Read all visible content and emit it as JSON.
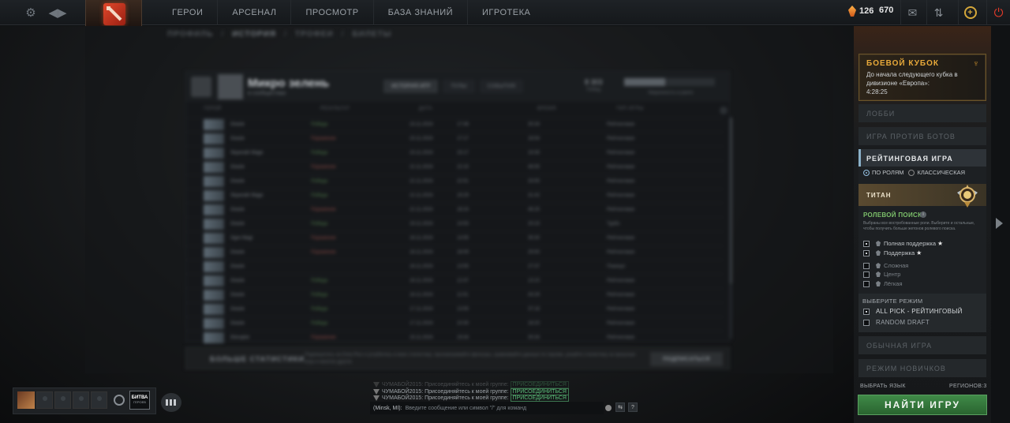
{
  "topbar": {
    "nav": [
      "ГЕРОИ",
      "АРСЕНАЛ",
      "ПРОСМОТР",
      "БАЗА ЗНАНИЙ",
      "ИГРОТЕКА"
    ],
    "shards": "126",
    "gems": "670",
    "icons": [
      "settings-gear-icon",
      "back-forward-icon",
      "dota-logo-icon",
      "mail-icon",
      "plus-icon",
      "power-icon"
    ]
  },
  "breadcrumb": [
    "ПРОФИЛЬ",
    "ИСТОРИЯ",
    "ТРОФЕИ",
    "БИЛЕТЫ"
  ],
  "profile": {
    "name": "Микро зелень",
    "subtitle": "в сообществах",
    "tabs": [
      "ИСТОРИЯ ИГР",
      "ПУЛЫ",
      "СОБЫТИЯ"
    ],
    "stat1": "8 303",
    "stat1_label": "Побед",
    "stat2_label": "Уверенность в ранге",
    "columns": [
      "ГЕРОЙ",
      "РЕЗУЛЬТАТ",
      "ДАТА",
      "",
      "ВРЕМЯ",
      "ТИП ИГРЫ"
    ],
    "matches": [
      {
        "hero": "Oracle",
        "result": "Победа",
        "date": "23.11.2024",
        "time": "17:48",
        "duration": "30:34",
        "type": "Рейтинговая",
        "win": true
      },
      {
        "hero": "Oracle",
        "result": "Поражение",
        "date": "23.11.2024",
        "time": "17:17",
        "duration": "18:54",
        "type": "Рейтинговая",
        "win": false
      },
      {
        "hero": "Skywrath Mage",
        "result": "Победа",
        "date": "23.11.2024",
        "time": "15:17",
        "duration": "19:35",
        "type": "Рейтинговая",
        "win": true
      },
      {
        "hero": "Oracle",
        "result": "Поражение",
        "date": "22.11.2024",
        "time": "22:15",
        "duration": "46:55",
        "type": "Рейтинговая",
        "win": false
      },
      {
        "hero": "Oracle",
        "result": "Победа",
        "date": "22.11.2024",
        "time": "22:51",
        "duration": "33:55",
        "type": "Рейтинговая",
        "win": true
      },
      {
        "hero": "Skywrath Mage",
        "result": "Победа",
        "date": "22.11.2024",
        "time": "19:29",
        "duration": "31:42",
        "type": "Рейтинговая",
        "win": true
      },
      {
        "hero": "Oracle",
        "result": "Поражение",
        "date": "22.11.2024",
        "time": "18:24",
        "duration": "46:25",
        "type": "Рейтинговая",
        "win": false
      },
      {
        "hero": "Oracle",
        "result": "Победа",
        "date": "19.11.2024",
        "time": "14:53",
        "duration": "20:23",
        "type": "Турбо",
        "win": true
      },
      {
        "hero": "Ogre Magi",
        "result": "Поражение",
        "date": "18.11.2024",
        "time": "14:55",
        "duration": "35:30",
        "type": "Рейтинговая",
        "win": false
      },
      {
        "hero": "Oracle",
        "result": "Поражение",
        "date": "18.11.2024",
        "time": "18:09",
        "duration": "25:50",
        "type": "Рейтинговая",
        "win": false
      },
      {
        "hero": "Oracle",
        "result": "",
        "date": "18.11.2024",
        "time": "13:55",
        "duration": "27:37",
        "type": "Покинул",
        "win": null
      },
      {
        "hero": "Oracle",
        "result": "Победа",
        "date": "18.11.2024",
        "time": "12:47",
        "duration": "13:10",
        "type": "Рейтинговая",
        "win": true
      },
      {
        "hero": "Oracle",
        "result": "Победа",
        "date": "18.11.2024",
        "time": "11:51",
        "duration": "43:29",
        "type": "Рейтинговая",
        "win": true
      },
      {
        "hero": "Oracle",
        "result": "Победа",
        "date": "17.11.2024",
        "time": "13:55",
        "duration": "37:18",
        "type": "Рейтинговая",
        "win": true
      },
      {
        "hero": "Oracle",
        "result": "Победа",
        "date": "17.11.2024",
        "time": "10:30",
        "duration": "18:20",
        "type": "Рейтинговая",
        "win": true
      },
      {
        "hero": "Disruptor",
        "result": "Поражение",
        "date": "15.11.2024",
        "time": "19:34",
        "duration": "30:34",
        "type": "Рейтинговая",
        "win": false
      }
    ]
  },
  "plus_banner": {
    "title": "БОЛЬШЕ СТАТИСТИКИ",
    "desc": "Подпишитесь на Dota Plus и углубитесь в мою статистику: просматривайте фильтры, сравнивайте данные по героям, узнайте статистику за прошлые игры и многое другое.",
    "button": "ПОДПИСАТЬСЯ"
  },
  "cup": {
    "title": "БОЕВОЙ КУБОК",
    "text": "До начала следующего кубка в дивизионе «Европа»:",
    "timer": "4:28:25"
  },
  "modes": {
    "lobby": "ЛОББИ",
    "bots": "ИГРА ПРОТИВ БОТОВ",
    "ranked": "РЕЙТИНГОВАЯ ИГРА",
    "unranked": "ОБЫЧНАЯ ИГРА",
    "newbie": "РЕЖИМ НОВИЧКОВ"
  },
  "ranked": {
    "radio_roles": "ПО РОЛЯМ",
    "radio_classic": "КЛАССИЧЕСКАЯ",
    "rank": "ТИТАН",
    "role_title": "РОЛЕВОЙ ПОИСК",
    "role_desc": "Выбраны все востребованные роли. Выберите и остальные, чтобы получить больше жетонов ролевого поиска.",
    "roles": [
      {
        "label": "Полная поддержка",
        "checked": true,
        "star": true
      },
      {
        "label": "Поддержка",
        "checked": true,
        "star": true
      },
      {
        "label": "Сложная",
        "checked": false,
        "star": false
      },
      {
        "label": "Центр",
        "checked": false,
        "star": false
      },
      {
        "label": "Лёгкая",
        "checked": false,
        "star": false
      }
    ],
    "mode_title": "ВЫБЕРИТЕ РЕЖИМ",
    "mode_options": [
      {
        "label": "ALL PICK - РЕЙТИНГОВЫЙ",
        "checked": true
      },
      {
        "label": "RANDOM DRAFT",
        "checked": false
      }
    ]
  },
  "footer": {
    "language": "ВЫБРАТЬ ЯЗЫК",
    "regions": "РЕГИОНОВ:3",
    "find": "НАЙТИ ИГРУ"
  },
  "party": {
    "battle_cup_line1": "БИТВА",
    "battle_cup_line2": "ГЕРОЕВ"
  },
  "chat": {
    "lines": [
      {
        "user": "ЧУМАБОЙ2015",
        "text": "Присоединяйтесь к моей группе:",
        "link": "ПРИСОЕДИНИТЬСЯ"
      },
      {
        "user": "ЧУМАБОЙ2015",
        "text": "Присоединяйтесь к моей группе:",
        "link": "ПРИСОЕДИНИТЬСЯ"
      },
      {
        "user": "ЧУМАБОЙ2015",
        "text": "Присоединяйтесь к моей группе:",
        "link": "ПРИСОЕДИНИТЬСЯ"
      }
    ],
    "channel": "(Minsk, MI):",
    "placeholder": "Введите сообщение или символ \"/\" для команд"
  }
}
